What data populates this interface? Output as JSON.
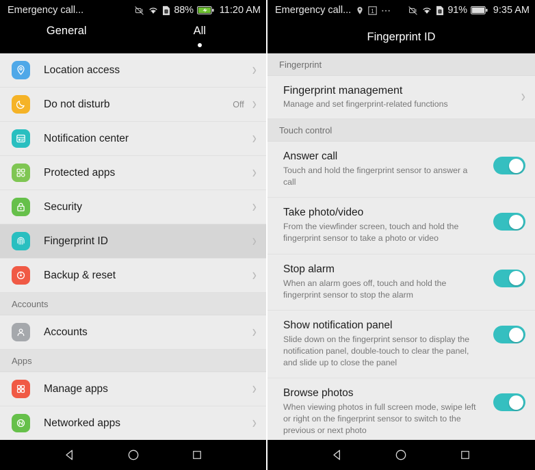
{
  "left": {
    "statusbar": {
      "carrier": "Emergency call...",
      "battery_pct": "88%",
      "time": "11:20 AM",
      "icons": [
        "vibrate-off-icon",
        "wifi-icon",
        "sim-card-icon",
        "battery-charging-icon"
      ]
    },
    "tabs": [
      {
        "label": "General",
        "active": false
      },
      {
        "label": "All",
        "active": true
      }
    ],
    "items": [
      {
        "type": "row",
        "label": "Location access",
        "value": "",
        "icon": "location-pin-icon",
        "color": "#4FA8E8",
        "selected": false
      },
      {
        "type": "row",
        "label": "Do not disturb",
        "value": "Off",
        "icon": "moon-icon",
        "color": "#F5B327",
        "selected": false
      },
      {
        "type": "row",
        "label": "Notification center",
        "value": "",
        "icon": "notification-center-icon",
        "color": "#29BFC0",
        "selected": false
      },
      {
        "type": "row",
        "label": "Protected apps",
        "value": "",
        "icon": "protected-apps-icon",
        "color": "#7FC653",
        "selected": false
      },
      {
        "type": "row",
        "label": "Security",
        "value": "",
        "icon": "lock-icon",
        "color": "#66C04A",
        "selected": false
      },
      {
        "type": "row",
        "label": "Fingerprint ID",
        "value": "",
        "icon": "fingerprint-icon",
        "color": "#29BFC0",
        "selected": true
      },
      {
        "type": "row",
        "label": "Backup & reset",
        "value": "",
        "icon": "backup-reset-icon",
        "color": "#F05A45",
        "selected": false
      },
      {
        "type": "header",
        "label": "Accounts"
      },
      {
        "type": "row",
        "label": "Accounts",
        "value": "",
        "icon": "person-icon",
        "color": "#A5A8AC",
        "selected": false
      },
      {
        "type": "header",
        "label": "Apps"
      },
      {
        "type": "row",
        "label": "Manage apps",
        "value": "",
        "icon": "grid-apps-icon",
        "color": "#F05A45",
        "selected": false
      },
      {
        "type": "row",
        "label": "Networked apps",
        "value": "",
        "icon": "networked-apps-icon",
        "color": "#66C04A",
        "selected": false
      }
    ],
    "navbar": [
      "back-icon",
      "home-icon",
      "recents-icon"
    ]
  },
  "right": {
    "statusbar": {
      "carrier": "Emergency call...",
      "battery_pct": "91%",
      "time": "9:35 AM",
      "notif_icons": [
        "location-pin-icon",
        "one-box-icon",
        "overflow-dots-icon"
      ],
      "icons": [
        "vibrate-off-icon",
        "wifi-icon",
        "sim-card-icon",
        "battery-icon"
      ]
    },
    "title": "Fingerprint ID",
    "items": [
      {
        "type": "header",
        "label": "Fingerprint"
      },
      {
        "type": "nav",
        "title": "Fingerprint management",
        "desc": "Manage and set fingerprint-related functions"
      },
      {
        "type": "header",
        "label": "Touch control"
      },
      {
        "type": "toggle",
        "title": "Answer call",
        "desc": "Touch and hold the fingerprint sensor to answer a call",
        "on": true
      },
      {
        "type": "toggle",
        "title": "Take photo/video",
        "desc": "From the viewfinder screen, touch and hold the fingerprint sensor to take a photo or video",
        "on": true
      },
      {
        "type": "toggle",
        "title": "Stop alarm",
        "desc": "When an alarm goes off, touch and hold the fingerprint sensor to stop the alarm",
        "on": true
      },
      {
        "type": "toggle",
        "title": "Show notification panel",
        "desc": "Slide down on the fingerprint sensor to display the notification panel, double-touch to clear the panel, and slide up to close the panel",
        "on": true
      },
      {
        "type": "toggle",
        "title": "Browse photos",
        "desc": "When viewing photos in full screen mode, swipe left or right on the fingerprint sensor to switch to the previous or next photo",
        "on": true
      }
    ],
    "navbar": [
      "back-icon",
      "home-icon",
      "recents-icon"
    ]
  },
  "colors": {
    "toggle_on": "#35BFC0",
    "list_bg": "#ECECEC",
    "section_bg": "#E2E2E2",
    "selected_row": "#D6D6D6",
    "statusbar_bg": "#000000"
  }
}
